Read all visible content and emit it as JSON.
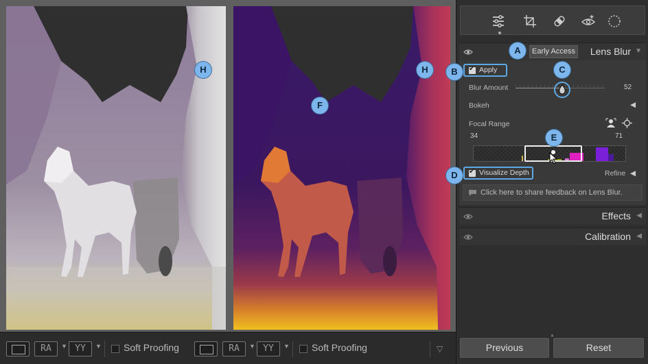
{
  "toolbar": {
    "pair_label": "RA",
    "pair_label_2": "YY",
    "soft_proofing_label": "Soft Proofing"
  },
  "panel": {
    "tools": [
      "sliders-icon",
      "crop-icon",
      "healing-icon",
      "redeye-icon",
      "masking-icon"
    ],
    "early_access": "Early Access",
    "lens_blur_title": "Lens Blur",
    "apply_label": "Apply",
    "blur_amount_label": "Blur Amount",
    "blur_amount_value": "52",
    "blur_amount_fraction": 0.52,
    "bokeh_label": "Bokeh",
    "focal_range_label": "Focal Range",
    "focal_min": "34",
    "focal_max": "71",
    "visualize_depth_label": "Visualize Depth",
    "refine_label": "Refine",
    "feedback_text": "Click here to share feedback on Lens Blur.",
    "effects_title": "Effects",
    "calibration_title": "Calibration",
    "previous_label": "Previous",
    "reset_label": "Reset"
  },
  "callouts": {
    "a": "A",
    "b": "B",
    "c": "C",
    "d": "D",
    "e": "E",
    "f": "F",
    "h": "H"
  },
  "colors": {
    "accent": "#7db6ec",
    "depth_far": "#2d0a55",
    "depth_near": "#f0c020"
  }
}
